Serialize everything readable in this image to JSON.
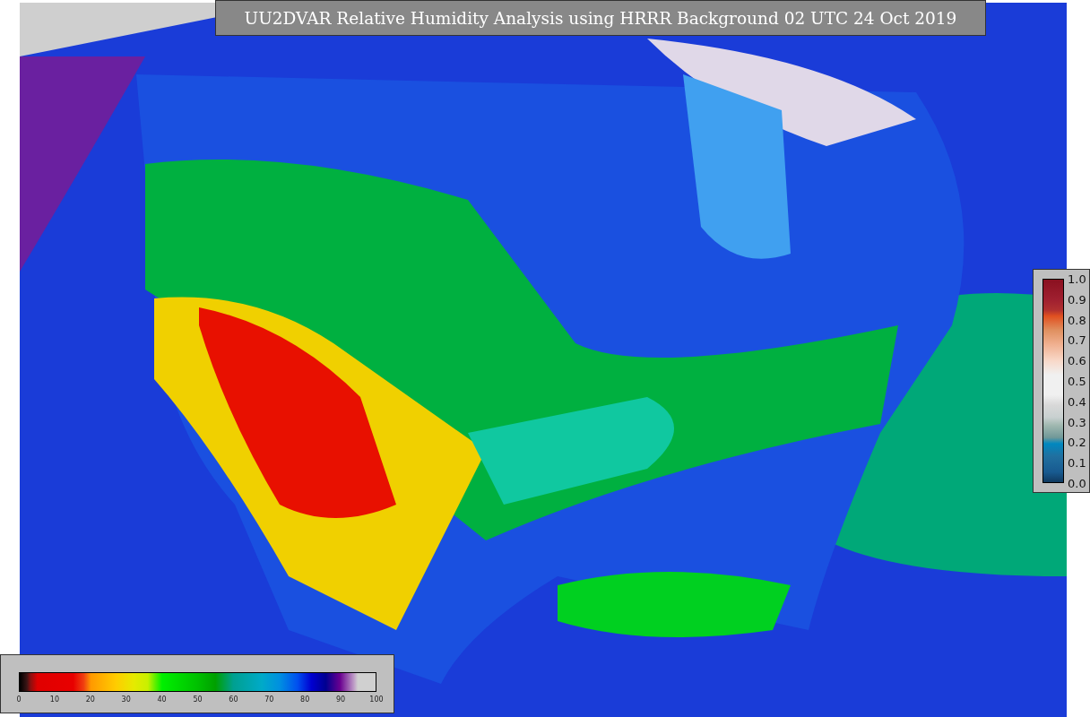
{
  "title": "UU2DVAR Relative Humidity Analysis using HRRR Background 02 UTC 24 Oct 2019",
  "humidity_colorbar": {
    "ticks": [
      "0",
      "10",
      "20",
      "30",
      "40",
      "50",
      "60",
      "70",
      "80",
      "90",
      "100"
    ]
  },
  "observation_colorbar": {
    "ticks": [
      "1.0",
      "0.9",
      "0.8",
      "0.7",
      "0.6",
      "0.5",
      "0.4",
      "0.3",
      "0.2",
      "0.1",
      "0.0"
    ]
  }
}
